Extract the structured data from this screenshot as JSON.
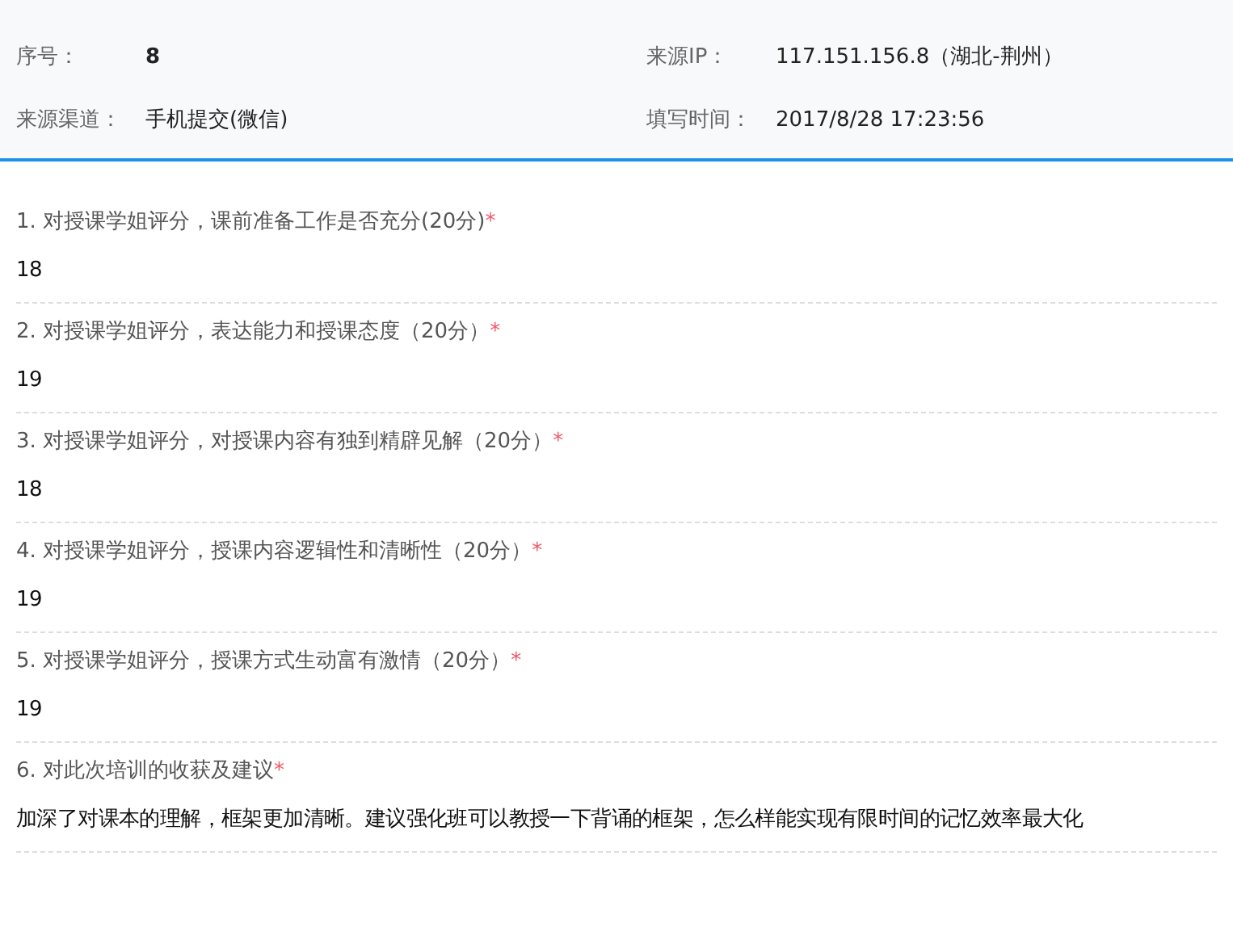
{
  "header": {
    "fields": [
      {
        "label": "序号：",
        "value": "8",
        "bold": true
      },
      {
        "label": "来源IP：",
        "value": "117.151.156.8（湖北-荆州）",
        "bold": false
      },
      {
        "label": "来源渠道：",
        "value": "手机提交(微信)",
        "bold": false
      },
      {
        "label": "填写时间：",
        "value": "2017/8/28 17:23:56",
        "bold": false
      }
    ]
  },
  "questions": [
    {
      "question": "1. 对授课学姐评分，课前准备工作是否充分(20分)",
      "required_mark": "*",
      "answer": "18"
    },
    {
      "question": "2. 对授课学姐评分，表达能力和授课态度（20分）",
      "required_mark": "*",
      "answer": "19"
    },
    {
      "question": "3. 对授课学姐评分，对授课内容有独到精辟见解（20分）",
      "required_mark": "*",
      "answer": "18"
    },
    {
      "question": "4. 对授课学姐评分，授课内容逻辑性和清晰性（20分）",
      "required_mark": "*",
      "answer": "19"
    },
    {
      "question": "5. 对授课学姐评分，授课方式生动富有激情（20分）",
      "required_mark": "*",
      "answer": "19"
    },
    {
      "question": "6. 对此次培训的收获及建议",
      "required_mark": "*",
      "answer": "加深了对课本的理解，框架更加清晰。建议强化班可以教授一下背诵的框架，怎么样能实现有限时间的记忆效率最大化"
    }
  ]
}
